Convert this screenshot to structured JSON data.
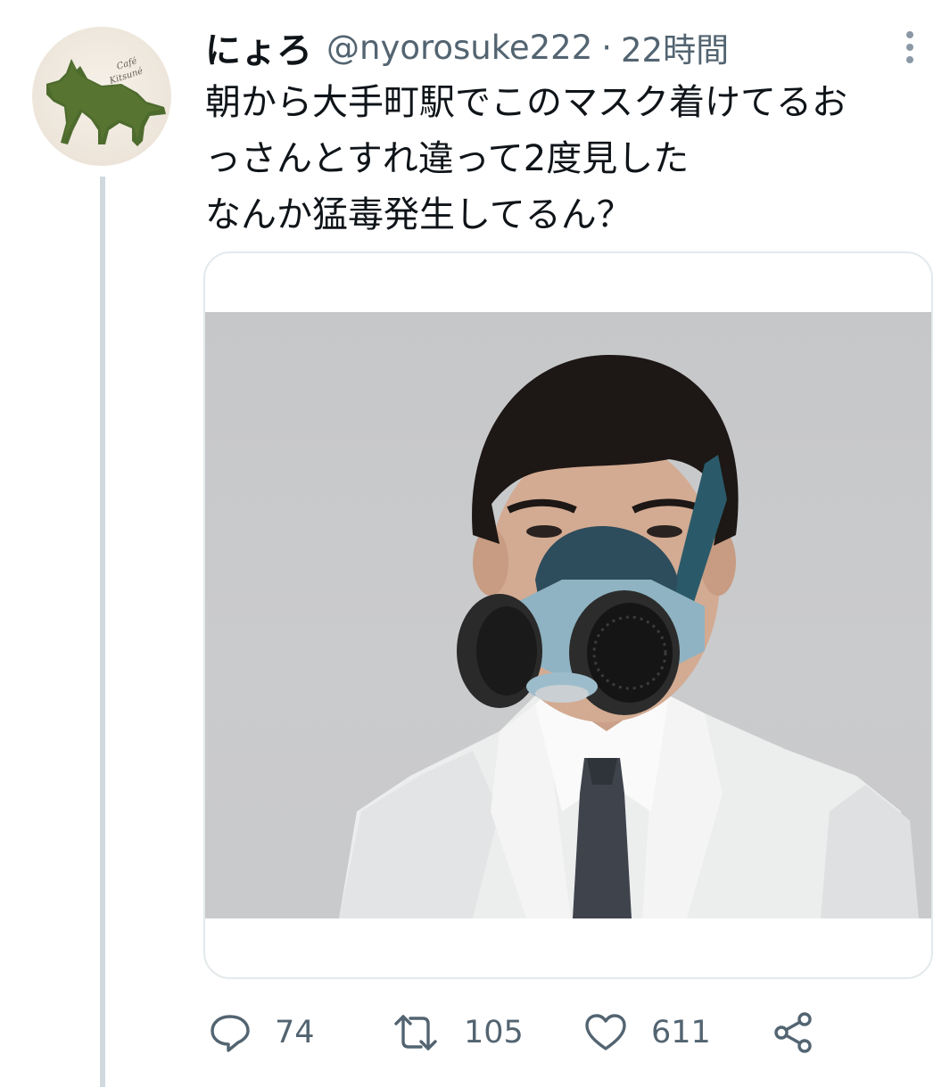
{
  "tweet": {
    "author": {
      "display_name": "にょろ",
      "handle": "@nyorosuke222",
      "avatar_icon": "fox-silhouette-avatar-icon",
      "avatar_text_line1": "Café",
      "avatar_text_line2": "Kitsuné"
    },
    "separator": "·",
    "timestamp": "22時間",
    "text_lines": [
      "朝から大手町駅でこのマスク着けてるお",
      "っさんとすれ違って2度見した",
      "なんか猛毒発生してるん？"
    ],
    "media": {
      "type": "photo",
      "description_icon": "man-in-respirator-mask-photo"
    },
    "stats": {
      "replies": "74",
      "retweets": "105",
      "likes": "611"
    },
    "icons": {
      "reply": "speech-bubble-icon",
      "retweet": "retweet-arrows-icon",
      "like": "heart-icon",
      "share": "share-nodes-icon",
      "more": "vertical-dots-icon"
    },
    "colors": {
      "text_primary": "#0f1419",
      "text_secondary": "#536471",
      "thread_line": "#cfd9de",
      "card_border": "#e4e9ec"
    }
  }
}
